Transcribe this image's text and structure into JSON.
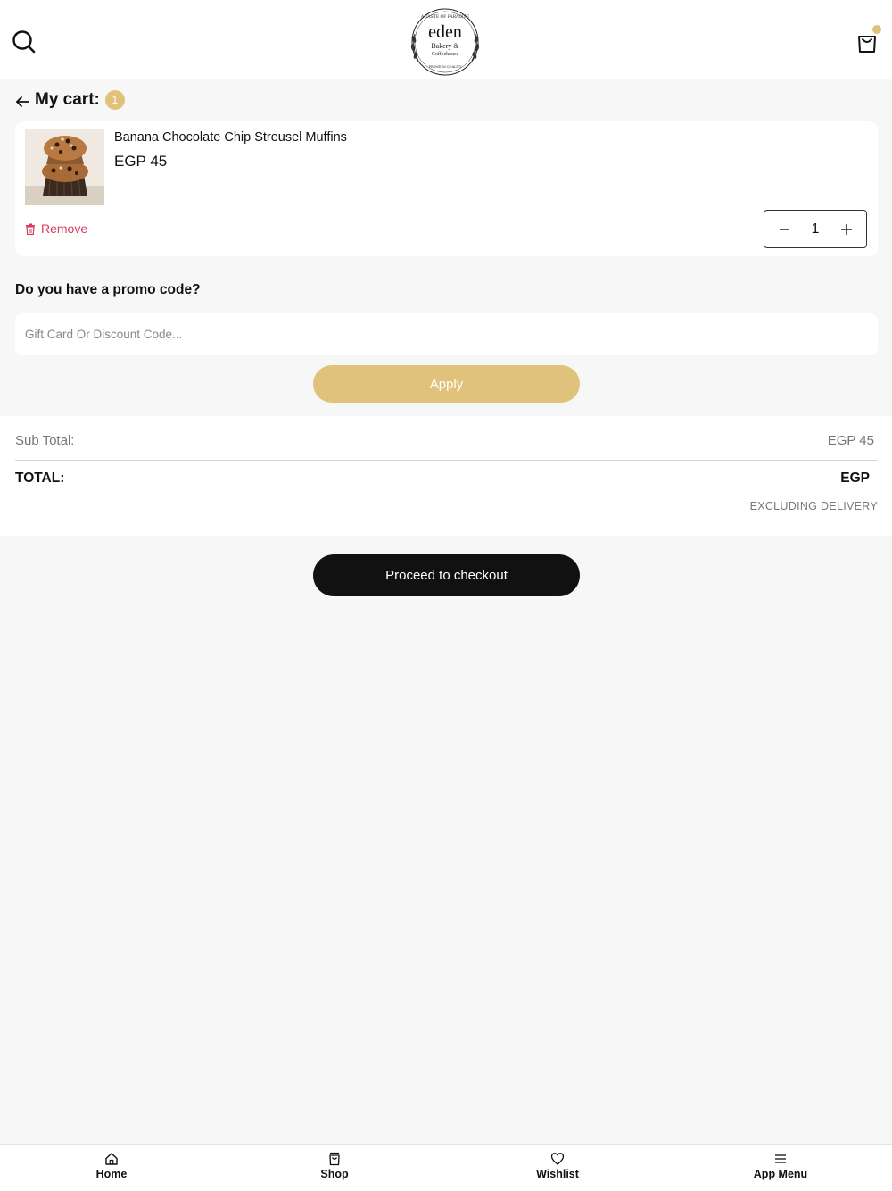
{
  "header": {
    "logo": {
      "brand": "eden",
      "subtitle_line1": "Bakery &",
      "subtitle_line2": "Coffeehouse",
      "arc_text": "A TASTE OF PARADISE",
      "bottom_text": "PREMIUM QUALITY"
    },
    "icons": {
      "search": "search-icon",
      "cart": "shopping-bag-icon"
    },
    "accent_color": "#e0c27a"
  },
  "cart": {
    "title": "My cart:",
    "count": "1",
    "item": {
      "name": "Banana Chocolate Chip Streusel Muffins",
      "price": "EGP 45",
      "remove_label": "Remove",
      "quantity": "1"
    }
  },
  "promo": {
    "label": "Do you have a promo code?",
    "placeholder": "Gift Card Or Discount Code...",
    "apply_label": "Apply"
  },
  "totals": {
    "subtotal_label": "Sub Total:",
    "subtotal_value": "EGP 45",
    "total_label": "TOTAL:",
    "total_value": "EGP",
    "note": "EXCLUDING DELIVERY"
  },
  "checkout": {
    "label": "Proceed to checkout"
  },
  "bottom_nav": {
    "items": [
      {
        "label": "Home",
        "icon": "home-icon"
      },
      {
        "label": "Shop",
        "icon": "shopping-bag-icon"
      },
      {
        "label": "Wishlist",
        "icon": "heart-icon"
      },
      {
        "label": "App Menu",
        "icon": "menu-icon"
      }
    ]
  },
  "colors": {
    "accent": "#e0c27a",
    "remove": "#d63a5e",
    "checkout": "#111111",
    "background": "#f7f7f7"
  }
}
